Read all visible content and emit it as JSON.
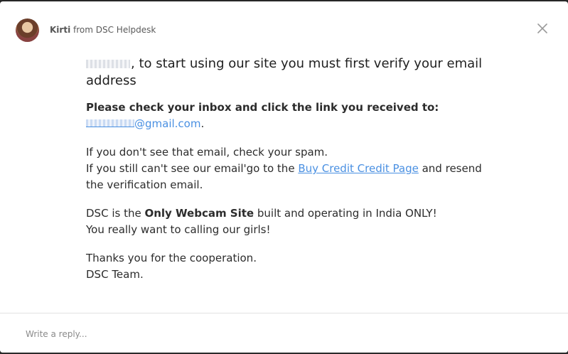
{
  "header": {
    "sender_name": "Kirti",
    "sender_org": "from DSC Helpdesk",
    "avatar_icon": "avatar-photo"
  },
  "close_icon": "close-icon",
  "message": {
    "headline_text": ", to start using our site you must first verify your email address",
    "instruction_text": "Please  check your inbox and click the link you received to:",
    "email_suffix": "@gmail.com",
    "email_period": ".",
    "spam_line_1": "If you don't see that email, check your spam.",
    "spam_line_2_pre": "If you still can't see our email'go to the ",
    "spam_link": "Buy Credit Credit Page",
    "spam_line_2_post": " and resend the verification email.",
    "dsc_pre": "DSC is the ",
    "dsc_bold": "Only Webcam Site",
    "dsc_post": " built and operating in India ONLY!",
    "dsc_line_2": "You really want to calling our girls!",
    "thanks_line_1": "Thanks you for the cooperation.",
    "thanks_line_2": "DSC Team."
  },
  "reply": {
    "placeholder": "Write a reply..."
  },
  "colors": {
    "link": "#4a90e2",
    "text": "#2c2c2c"
  }
}
